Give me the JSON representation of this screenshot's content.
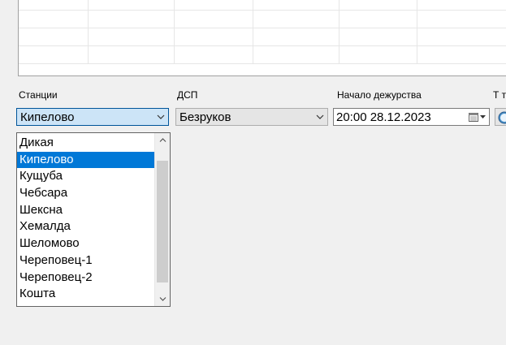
{
  "labels": {
    "stations": "Станции",
    "dsp": "ДСП",
    "duty_start": "Начало дежурства",
    "next_truncated": "Т т"
  },
  "stations_combo": {
    "value": "Кипелово"
  },
  "dsp_combo": {
    "value": "Безруков"
  },
  "duty_start_picker": {
    "value": "20:00 28.12.2023"
  },
  "station_list": {
    "items": [
      "Дикая",
      "Кипелово",
      "Кущуба",
      "Чебсара",
      "Шексна",
      "Хемалда",
      "Шеломово",
      "Череповец-1",
      "Череповец-2",
      "Кошта"
    ],
    "selected": "Кипелово"
  },
  "colors": {
    "selection": "#0078d7",
    "focused_combo_bg": "#cce4f7",
    "focused_combo_border": "#005499"
  },
  "icons": {
    "combo_arrow": "chevron-down-icon",
    "calendar": "calendar-icon",
    "clock": "clock-icon",
    "scroll_up": "scroll-up-arrow-icon",
    "scroll_down": "scroll-down-arrow-icon"
  }
}
